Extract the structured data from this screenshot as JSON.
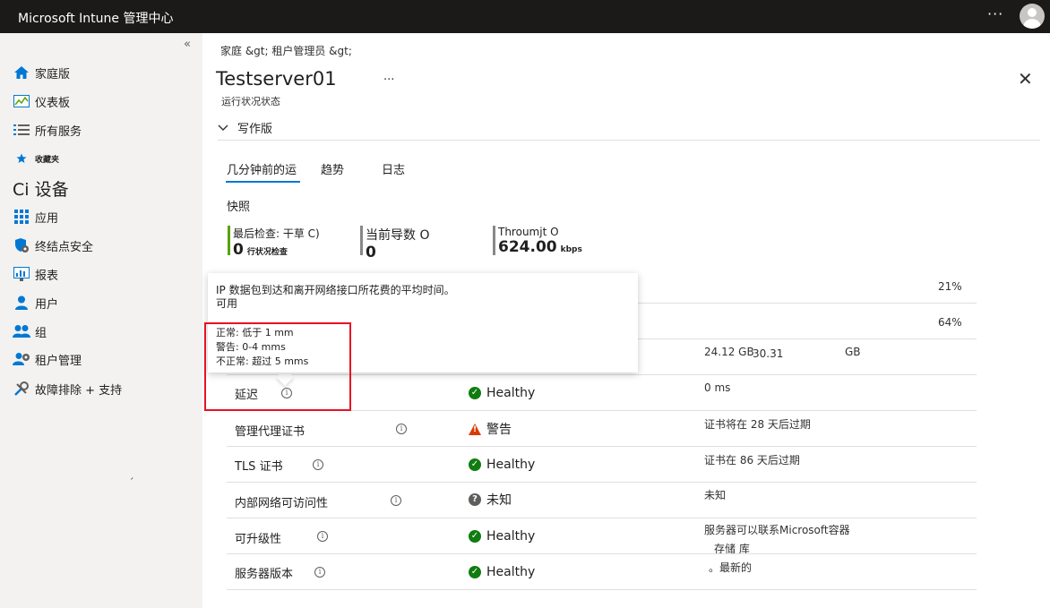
{
  "topbar": {
    "title": "Microsoft Intune 管理中心",
    "more": "···"
  },
  "sidebar": {
    "collapse": "«",
    "items": [
      {
        "label": "家庭版",
        "icon": "home-icon"
      },
      {
        "label": "仪表板",
        "icon": "dashboard-icon"
      },
      {
        "label": "所有服务",
        "icon": "list-icon"
      },
      {
        "label": "收藏夹",
        "icon": "star-icon"
      },
      {
        "label": "Ci 设备",
        "icon": ""
      },
      {
        "label": "应用",
        "icon": "apps-grid-icon"
      },
      {
        "label": "终结点安全",
        "icon": "shield-icon"
      },
      {
        "label": "报表",
        "icon": "reports-icon"
      },
      {
        "label": "用户",
        "icon": "user-icon"
      },
      {
        "label": "组",
        "icon": "group-icon"
      },
      {
        "label": "租户管理",
        "icon": "tenant-icon"
      },
      {
        "label": "故障排除 + 支持",
        "icon": "wrench-icon"
      }
    ],
    "mark": "ˏ"
  },
  "breadcrumb": "家庭 &gt;  租户管理员 &gt;",
  "page": {
    "title": "Testserver01",
    "more": "···",
    "subtitle": "运行状况状态",
    "close": "✕"
  },
  "section": {
    "chevron": "﹀",
    "label": "写作版"
  },
  "tabs": [
    "几分钟前的运",
    "趋势",
    "日志"
  ],
  "snapshot": {
    "label": "快照",
    "metrics": [
      {
        "label": "最后检查: 干草 C)",
        "value": "0",
        "unit": "行状况检查",
        "color": "#57a300"
      },
      {
        "label": "当前导数 O",
        "value": "0",
        "unit": "",
        "color": "#8a8886"
      },
      {
        "label": "Throumjt O",
        "value": "624.00",
        "unit": "kbps",
        "color": "#8a8886"
      }
    ]
  },
  "tooltip": {
    "line1": "IP 数据包到达和离开网络接口所花费的平均时间。",
    "line2": "可用",
    "normal": "正常: 低于 1 mm",
    "warning": "警告: 0-4 mms",
    "abnormal": "不正常: 超过 5 mms"
  },
  "hidden_rows": {
    "r1_detail": "21%",
    "r2_detail": "64%",
    "r3_detail_a": "24.12 GB",
    "r3_detail_b": "30.31",
    "r3_detail_c": "GB"
  },
  "rows": [
    {
      "name": "延迟",
      "status": "Healthy",
      "status_type": "ok",
      "detail": "0 ms",
      "detail2": ""
    },
    {
      "name": "管理代理证书",
      "status": "警告",
      "status_type": "warn",
      "detail": "证书将在 28 天后过期",
      "detail2": ""
    },
    {
      "name": "TLS 证书",
      "status": "Healthy",
      "status_type": "ok",
      "detail": "证书在 86 天后过期",
      "detail2": ""
    },
    {
      "name": "内部网络可访问性",
      "status": "未知",
      "status_type": "unknown",
      "detail": "未知",
      "detail2": ""
    },
    {
      "name": "可升级性",
      "status": "Healthy",
      "status_type": "ok",
      "detail": "服务器可以联系Microsoft容器",
      "detail2": "存储 库"
    },
    {
      "name": "服务器版本",
      "status": "Healthy",
      "status_type": "ok",
      "detail": "。最新的",
      "detail2": ""
    }
  ],
  "colors": {
    "accent": "#0078d4",
    "healthy": "#107c10",
    "warning": "#d83b01",
    "highlight": "#e81123"
  }
}
